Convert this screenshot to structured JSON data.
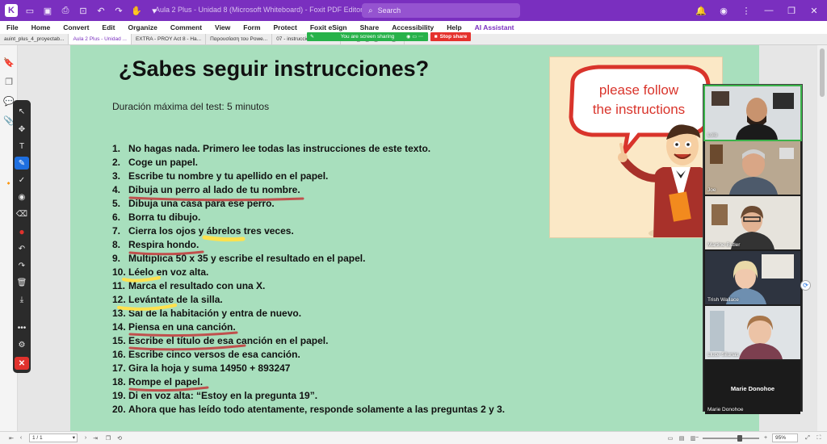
{
  "app": {
    "window_title": "Aula 2 Plus - Unidad 8 (Microsoft Whiteboard) - Foxit PDF Editor",
    "search_placeholder": "Search"
  },
  "menu": [
    "File",
    "Home",
    "Convert",
    "Edit",
    "Organize",
    "Comment",
    "View",
    "Form",
    "Protect",
    "Foxit eSign",
    "Share",
    "Accessibility",
    "Help",
    "AI Assistant"
  ],
  "tabs": [
    {
      "label": "auint_plus_4_proyectab...",
      "active": false
    },
    {
      "label": "Aula 2 Plus - Unidad ...",
      "active": true
    },
    {
      "label": "EXTRA - PROY Act 8 - Ha...",
      "active": false
    },
    {
      "label": "Παρουσίαση του Powe...",
      "active": false
    },
    {
      "label": "07 - instrucciones-locali...",
      "active": false
    },
    {
      "label": "CUIA_02_87_PROY_...",
      "active": false
    }
  ],
  "screen_share": {
    "banner": "You are screen sharing",
    "stop_label": "Stop share"
  },
  "document": {
    "title": "¿Sabes seguir instrucciones?",
    "subtitle": "Duración máxima del test: 5 minutos",
    "items": [
      {
        "num": "1.",
        "text": "No hagas nada. Primero lee todas las instrucciones de este texto."
      },
      {
        "num": "2.",
        "text": "Coge un papel."
      },
      {
        "num": "3.",
        "text": "Escribe tu nombre y tu apellido en el papel."
      },
      {
        "num": "4.",
        "text": "Dibuja un perro al lado de tu nombre."
      },
      {
        "num": "5.",
        "text": "Dibuja una casa para ese perro."
      },
      {
        "num": "6.",
        "text": "Borra tu dibujo."
      },
      {
        "num": "7.",
        "text": "Cierra los ojos y ábrelos tres veces."
      },
      {
        "num": "8.",
        "text": "Respira hondo."
      },
      {
        "num": "9.",
        "text": " Multiplica 50 x 35 y escribe el resultado en el papel."
      },
      {
        "num": "10.",
        "text": "Léelo en voz alta."
      },
      {
        "num": "11.",
        "text": "Marca el resultado con una X."
      },
      {
        "num": "12.",
        "text": "Levántate de la silla."
      },
      {
        "num": "13.",
        "text": "Sal de la habitación y entra de nuevo."
      },
      {
        "num": "14.",
        "text": "Piensa en una canción."
      },
      {
        "num": "15.",
        "text": "Escribe el título de esa canción en el papel."
      },
      {
        "num": "16.",
        "text": "Escribe cinco versos de esa canción."
      },
      {
        "num": "17.",
        "text": "Gira la hoja y suma 14950 + 893247"
      },
      {
        "num": "18.",
        "text": "Rompe el papel."
      },
      {
        "num": "19.",
        "text": "Di en voz alta: “Estoy en la pregunta 19”."
      },
      {
        "num": "20.",
        "text": "Ahora que has leído todo atentamente, responde solamente a las preguntas 2 y 3."
      }
    ],
    "illustration_caption_1": "please follow",
    "illustration_caption_2": "the instructions"
  },
  "participants": [
    {
      "name": "Lolo",
      "active": true
    },
    {
      "name": "Joe",
      "active": false
    },
    {
      "name": "Martine Butler",
      "active": false
    },
    {
      "name": "Trish Wallace",
      "active": false
    },
    {
      "name": "Lluce Silunas",
      "active": false
    },
    {
      "name": "Marie Donohoe",
      "active": false,
      "camera_off": true
    }
  ],
  "status": {
    "page_indicator": "1 / 1",
    "zoom": "95%"
  },
  "colors": {
    "brand": "#7a2fbf",
    "page_background": "#a8dfbd",
    "share_green": "#27b24a",
    "stop_red": "#e5322d",
    "highlight_red": "#c0504d",
    "highlight_yellow": "#ffe14d"
  }
}
